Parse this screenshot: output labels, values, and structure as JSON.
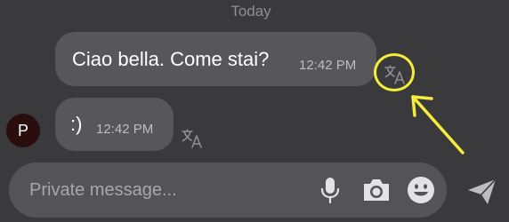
{
  "conversation": {
    "date_separator": "Today",
    "messages": [
      {
        "text": "Ciao bella. Come stai?",
        "time": "12:42 PM",
        "direction": "outgoing"
      },
      {
        "text": ":)",
        "time": "12:42 PM",
        "direction": "incoming",
        "avatar_initial": "P"
      }
    ]
  },
  "composer": {
    "placeholder": "Private message..."
  },
  "icons": {
    "translate": "translate-icon",
    "mic": "microphone-icon",
    "camera": "camera-icon",
    "emoji": "emoji-icon",
    "send": "send-icon"
  },
  "colors": {
    "background": "#3a3a3c",
    "bubble": "#57575b",
    "composer": "#545458",
    "highlight": "#f5ec3b",
    "avatar": "#2a0e0e"
  }
}
